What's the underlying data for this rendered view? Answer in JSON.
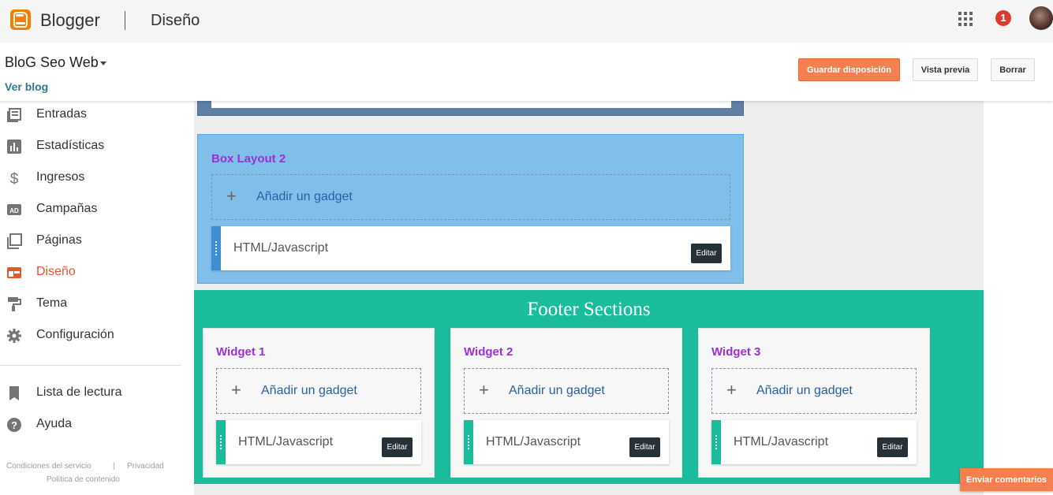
{
  "app": {
    "brand": "Blogger",
    "section": "Diseño",
    "notification_count": "1"
  },
  "header": {
    "blog_name": "BloG Seo Web",
    "view_blog": "Ver blog",
    "buttons": {
      "save": "Guardar disposición",
      "preview": "Vista previa",
      "clear": "Borrar"
    }
  },
  "sidebar": {
    "items": [
      {
        "label": "Entradas",
        "icon": "posts-icon"
      },
      {
        "label": "Estadísticas",
        "icon": "stats-icon"
      },
      {
        "label": "Ingresos",
        "icon": "dollar-icon"
      },
      {
        "label": "Campañas",
        "icon": "ad-icon"
      },
      {
        "label": "Páginas",
        "icon": "pages-icon"
      },
      {
        "label": "Diseño",
        "icon": "layout-icon",
        "active": true
      },
      {
        "label": "Tema",
        "icon": "paint-roller-icon"
      },
      {
        "label": "Configuración",
        "icon": "gear-icon"
      }
    ],
    "secondary": [
      {
        "label": "Lista de lectura",
        "icon": "bookmark-icon"
      },
      {
        "label": "Ayuda",
        "icon": "help-icon"
      }
    ],
    "footer": {
      "terms": "Condiciones del servicio",
      "separator": "|",
      "privacy": "Privacidad",
      "content_policy": "Política de contenido"
    }
  },
  "layout": {
    "box2": {
      "title": "Box Layout 2",
      "add_gadget": "Añadir un gadget",
      "widget": {
        "name": "HTML/Javascript",
        "edit": "Editar"
      }
    },
    "footer": {
      "title": "Footer Sections",
      "widgets": [
        {
          "title": "Widget 1",
          "add_gadget": "Añadir un gadget",
          "gadget_name": "HTML/Javascript",
          "edit": "Editar"
        },
        {
          "title": "Widget 2",
          "add_gadget": "Añadir un gadget",
          "gadget_name": "HTML/Javascript",
          "edit": "Editar"
        },
        {
          "title": "Widget 3",
          "add_gadget": "Añadir un gadget",
          "gadget_name": "HTML/Javascript",
          "edit": "Editar"
        }
      ]
    }
  },
  "feedback_button": "Enviar comentarios",
  "colors": {
    "accent": "#f47f4f",
    "active_nav": "#e8542a",
    "box1_bg": "#5f7fa5",
    "box2_bg": "#7fbfea",
    "footer_bg": "#1abc9c",
    "section_title": "#9b30d9",
    "edit_button": "#263238"
  }
}
